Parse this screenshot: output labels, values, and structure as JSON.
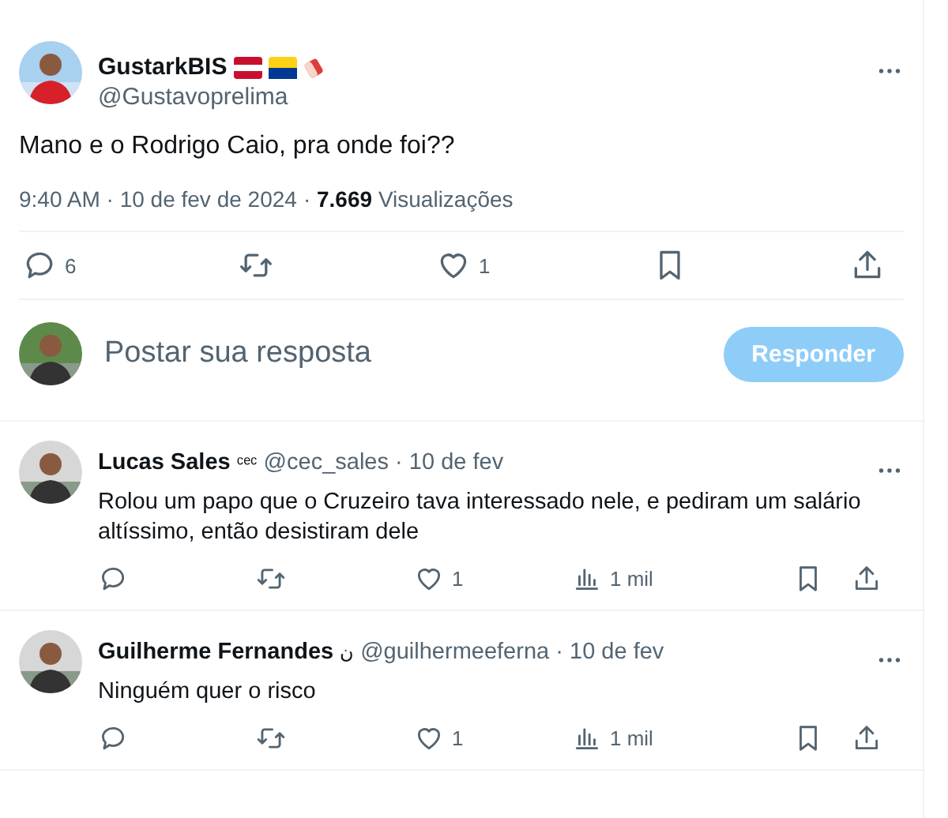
{
  "post": {
    "author": {
      "name": "GustarkBIS",
      "handle": "@Gustavoprelima",
      "flags": [
        {
          "color": "#c8102e"
        },
        {
          "color": "#fcd116"
        }
      ]
    },
    "text": "Mano e o Rodrigo Caio, pra onde foi??",
    "meta": {
      "time": "9:40 AM",
      "separator": "·",
      "date": "10 de fev de 2024",
      "views_count": "7.669",
      "views_label": "Visualizações"
    },
    "actions": [
      {
        "kind": "reply",
        "count": "6"
      },
      {
        "kind": "repost"
      },
      {
        "kind": "like",
        "count": "1"
      },
      {
        "kind": "bookmark"
      },
      {
        "kind": "share"
      }
    ]
  },
  "composer": {
    "placeholder": "Postar sua resposta",
    "button": {
      "label": "Responder",
      "disabled": true
    }
  },
  "replies": [
    {
      "name": "Lucas Sales",
      "badge": "ᶜᵉᶜ",
      "handle": "@cec_sales",
      "separator": "·",
      "date": "10 de fev",
      "text": "Rolou um papo que o Cruzeiro tava interessado nele, e pediram um salário altíssimo, então desistiram dele",
      "actions": [
        {
          "kind": "reply"
        },
        {
          "kind": "repost"
        },
        {
          "kind": "like",
          "count": "1"
        },
        {
          "kind": "views",
          "count": "1 mil"
        },
        {
          "kind": "bookmark"
        },
        {
          "kind": "share"
        }
      ]
    },
    {
      "name": "Guilherme Fernandes",
      "badge": "ن",
      "handle": "@guilhermeeferna",
      "separator": "·",
      "date": "10 de fev",
      "text": "Ninguém quer o risco",
      "actions": [
        {
          "kind": "reply"
        },
        {
          "kind": "repost"
        },
        {
          "kind": "like",
          "count": "1"
        },
        {
          "kind": "views",
          "count": "1 mil"
        },
        {
          "kind": "bookmark"
        },
        {
          "kind": "share"
        }
      ]
    }
  ]
}
